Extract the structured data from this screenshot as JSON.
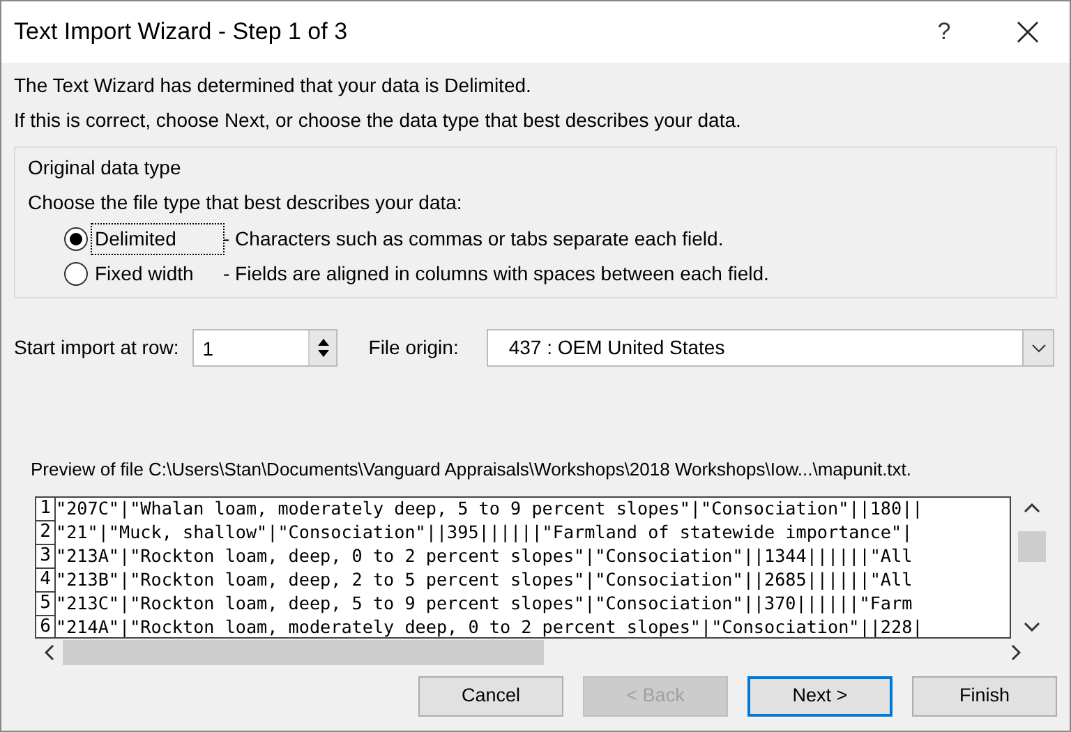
{
  "window": {
    "title": "Text Import Wizard - Step 1 of 3",
    "help": "?"
  },
  "intro": [
    "The Text Wizard has determined that your data is Delimited.",
    "If this is correct, choose Next, or choose the data type that best describes your data."
  ],
  "group": {
    "title": "Original data type",
    "prompt": "Choose the file type that best describes your data:",
    "options": [
      {
        "label": "Delimited",
        "description": "- Characters such as commas or tabs separate each field.",
        "selected": true
      },
      {
        "label": "Fixed width",
        "description": "- Fields are aligned in columns with spaces between each field.",
        "selected": false
      }
    ]
  },
  "start_row": {
    "label": "Start import at row:",
    "value": "1"
  },
  "file_origin": {
    "label": "File origin:",
    "value": "437 : OEM United States"
  },
  "preview": {
    "caption": "Preview of file C:\\Users\\Stan\\Documents\\Vanguard Appraisals\\Workshops\\2018 Workshops\\Iow...\\mapunit.txt.",
    "lines": [
      {
        "number": "1",
        "text": "\"207C\"|\"Whalan loam, moderately deep, 5 to 9 percent slopes\"|\"Consociation\"||180||"
      },
      {
        "number": "2",
        "text": "\"21\"|\"Muck, shallow\"|\"Consociation\"||395||||||\"Farmland of statewide importance\"|"
      },
      {
        "number": "3",
        "text": "\"213A\"|\"Rockton loam, deep, 0 to 2 percent slopes\"|\"Consociation\"||1344||||||\"All"
      },
      {
        "number": "4",
        "text": "\"213B\"|\"Rockton loam, deep, 2 to 5 percent slopes\"|\"Consociation\"||2685||||||\"All"
      },
      {
        "number": "5",
        "text": "\"213C\"|\"Rockton loam, deep, 5 to 9 percent slopes\"|\"Consociation\"||370||||||\"Farm"
      },
      {
        "number": "6",
        "text": "\"214A\"|\"Rockton loam, moderately deep, 0 to 2 percent slopes\"|\"Consociation\"||228|"
      }
    ]
  },
  "buttons": [
    {
      "label": "Cancel",
      "disabled": false,
      "default": false
    },
    {
      "label": "< Back",
      "disabled": true,
      "default": false
    },
    {
      "label": "Next >",
      "disabled": false,
      "default": true
    },
    {
      "label": "Finish",
      "disabled": false,
      "default": false
    }
  ]
}
